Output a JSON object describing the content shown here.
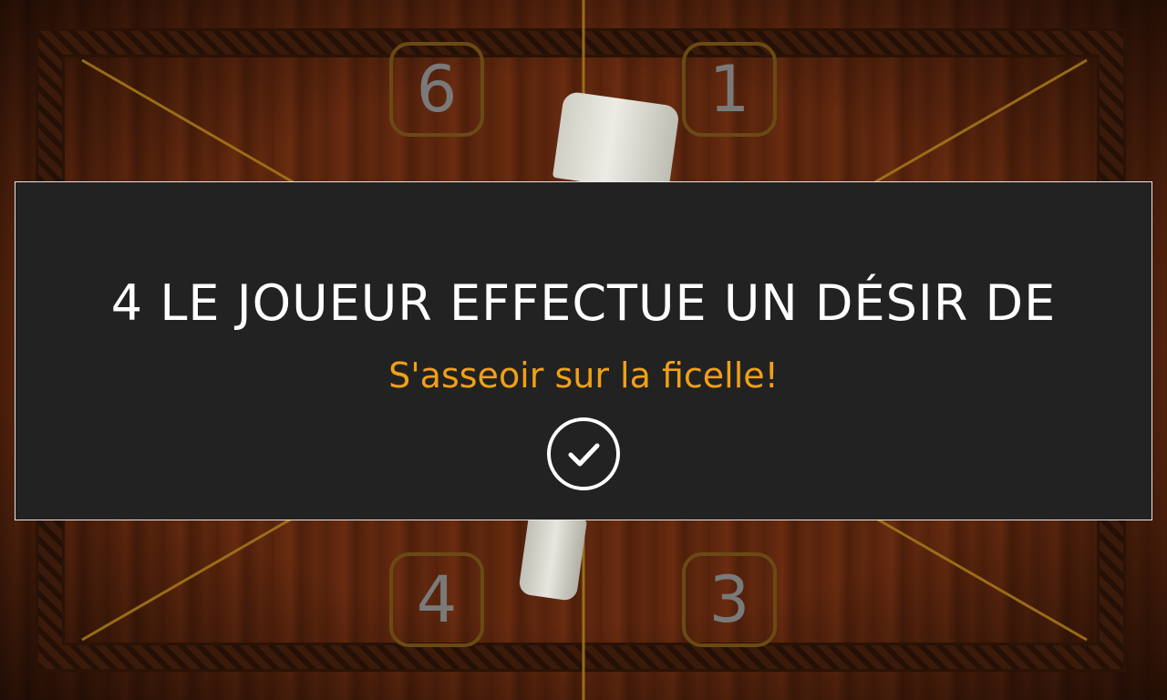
{
  "board": {
    "zones": [
      {
        "id": "6",
        "label": "6"
      },
      {
        "id": "1",
        "label": "1"
      },
      {
        "id": "4",
        "label": "4"
      },
      {
        "id": "3",
        "label": "3"
      }
    ]
  },
  "modal": {
    "title": "4 LE JOUEUR EFFECTUE UN DÉSIR DE",
    "subtitle": "S'asseoir sur la ficelle!",
    "confirm_icon": "check-circle-icon"
  },
  "colors": {
    "modal_background": "#222222",
    "title": "#ffffff",
    "subtitle": "#f0a018",
    "zone_border": "#6a4a14",
    "zone_number": "#7a7a7a"
  }
}
